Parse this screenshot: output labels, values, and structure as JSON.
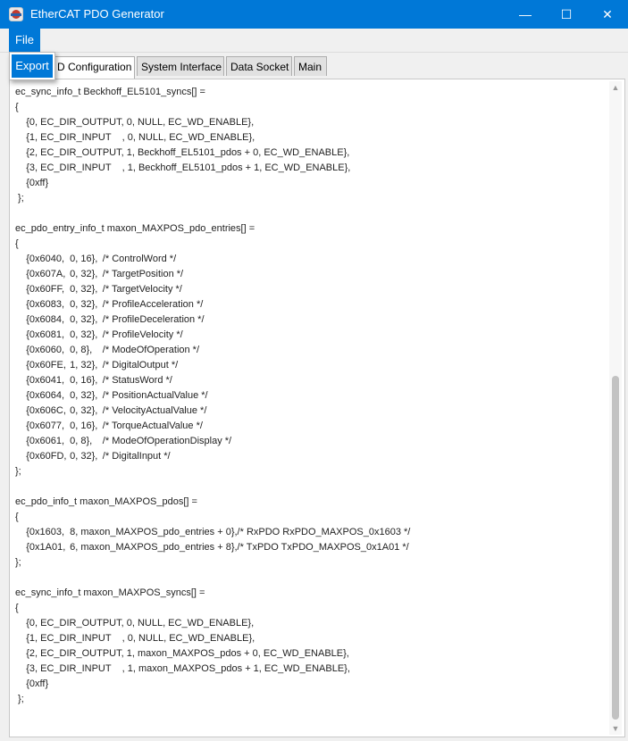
{
  "window": {
    "title": "EtherCAT PDO Generator",
    "minimize_glyph": "—",
    "maximize_glyph": "☐",
    "close_glyph": "✕"
  },
  "menu": {
    "file_label": "File",
    "dropdown_items": [
      "Export"
    ]
  },
  "tabs": [
    {
      "label": "PDO Configuration",
      "visible_label": "D Configuration",
      "active": true
    },
    {
      "label": "System Interface",
      "active": false
    },
    {
      "label": "Data Socket",
      "active": false
    },
    {
      "label": "Main",
      "active": false
    }
  ],
  "code_lines": [
    "ec_sync_info_t Beckhoff_EL5101_syncs[] =",
    "{",
    "\t{0, EC_DIR_OUTPUT, 0, NULL, EC_WD_ENABLE},",
    "\t{1, EC_DIR_INPUT    , 0, NULL, EC_WD_ENABLE},",
    "\t{2, EC_DIR_OUTPUT, 1, Beckhoff_EL5101_pdos + 0, EC_WD_ENABLE},",
    "\t{3, EC_DIR_INPUT    , 1, Beckhoff_EL5101_pdos + 1, EC_WD_ENABLE},",
    "\t{0xff}",
    " };",
    "",
    "ec_pdo_entry_info_t maxon_MAXPOS_pdo_entries[] =",
    "{",
    "\t{0x6040,\t0,\t16},\t/* ControlWord */",
    "\t{0x607A,\t0,\t32},\t/* TargetPosition */",
    "\t{0x60FF,\t0,\t32},\t/* TargetVelocity */",
    "\t{0x6083,\t0,\t32},\t/* ProfileAcceleration */",
    "\t{0x6084,\t0,\t32},\t/* ProfileDeceleration */",
    "\t{0x6081,\t0,\t32},\t/* ProfileVelocity */",
    "\t{0x6060,\t0,\t8},\t/* ModeOfOperation */",
    "\t{0x60FE,\t1,\t32},\t/* DigitalOutput */",
    "\t{0x6041,\t0,\t16},\t/* StatusWord */",
    "\t{0x6064,\t0,\t32},\t/* PositionActualValue */",
    "\t{0x606C,\t0,\t32},\t/* VelocityActualValue */",
    "\t{0x6077,\t0,\t16},\t/* TorqueActualValue */",
    "\t{0x6061,\t0,\t8},\t/* ModeOfOperationDisplay */",
    "\t{0x60FD,\t0,\t32},\t/* DigitalInput */",
    "};",
    "",
    "ec_pdo_info_t maxon_MAXPOS_pdos[] =",
    "{",
    "\t{0x1603,\t8,\tmaxon_MAXPOS_pdo_entries + 0},/* RxPDO RxPDO_MAXPOS_0x1603 */",
    "\t{0x1A01,\t6,\tmaxon_MAXPOS_pdo_entries + 8},/* TxPDO TxPDO_MAXPOS_0x1A01 */",
    "};",
    "",
    "ec_sync_info_t maxon_MAXPOS_syncs[] =",
    "{",
    "\t{0, EC_DIR_OUTPUT, 0, NULL, EC_WD_ENABLE},",
    "\t{1, EC_DIR_INPUT    , 0, NULL, EC_WD_ENABLE},",
    "\t{2, EC_DIR_OUTPUT, 1, maxon_MAXPOS_pdos + 0, EC_WD_ENABLE},",
    "\t{3, EC_DIR_INPUT    , 1, maxon_MAXPOS_pdos + 1, EC_WD_ENABLE},",
    "\t{0xff}",
    " };"
  ],
  "colors": {
    "accent": "#0078d7",
    "background": "#f0f0f0",
    "editor_background": "#ffffff"
  }
}
